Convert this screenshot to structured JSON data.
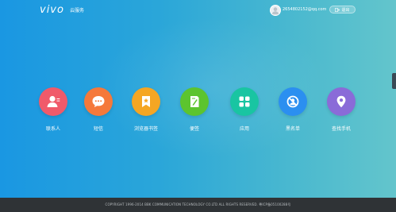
{
  "header": {
    "logo": "vivo",
    "service_name": "云服务",
    "account": "2654802152@qq.com",
    "logout_label": "退出"
  },
  "apps": [
    {
      "label": "联系人",
      "icon": "contacts-icon",
      "color": "#f05a6a"
    },
    {
      "label": "短信",
      "icon": "message-icon",
      "color": "#f5793b"
    },
    {
      "label": "浏览器书签",
      "icon": "bookmark-icon",
      "color": "#f5a623"
    },
    {
      "label": "便签",
      "icon": "note-icon",
      "color": "#5cc42f"
    },
    {
      "label": "应用",
      "icon": "apps-icon",
      "color": "#19c5a2"
    },
    {
      "label": "黑名单",
      "icon": "blacklist-icon",
      "color": "#2b8ff0"
    },
    {
      "label": "查找手机",
      "icon": "location-icon",
      "color": "#8a6bd8"
    }
  ],
  "footer": {
    "copyright": "COPYRIGHT 1996-2014 BBK COMMUNICATION TECHNOLOGY CO.LTD ALL RIGHTS RESERVED. 粤ICP备05100288号"
  }
}
